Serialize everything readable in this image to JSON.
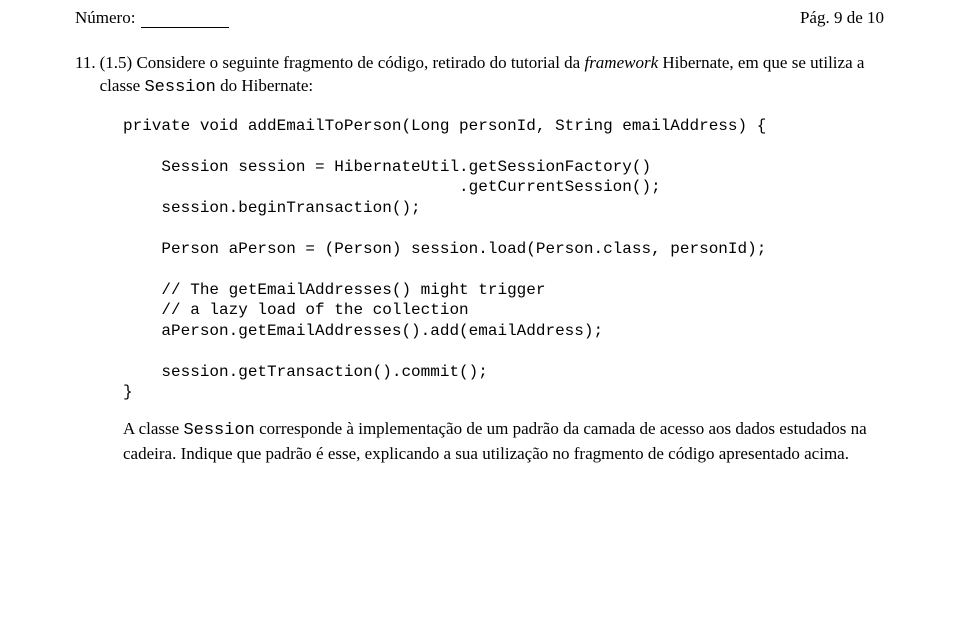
{
  "header": {
    "numero_label": "Número:",
    "page_label": "Pág. 9 de 10"
  },
  "question": {
    "num": "11.",
    "points": "(1.5)",
    "text_part1": " Considere o seguinte fragmento de código, retirado do tutorial da ",
    "framework_word": "framework",
    "text_part2": " Hibernate, em que se utiliza a classe ",
    "session_word": "Session",
    "text_part3": " do Hibernate:"
  },
  "code": {
    "line1": "private void addEmailToPerson(Long personId, String emailAddress) {",
    "line2": "",
    "line3": "    Session session = HibernateUtil.getSessionFactory()",
    "line4": "                                   .getCurrentSession();",
    "line5": "    session.beginTransaction();",
    "line6": "",
    "line7": "    Person aPerson = (Person) session.load(Person.class, personId);",
    "line8": "",
    "line9": "    // The getEmailAddresses() might trigger",
    "line10": "    // a lazy load of the collection",
    "line11": "    aPerson.getEmailAddresses().add(emailAddress);",
    "line12": "",
    "line13": "    session.getTransaction().commit();",
    "line14": "}"
  },
  "closing": {
    "part1": "A classe ",
    "session_word": "Session",
    "part2": " corresponde à implementação de um padrão da camada de acesso aos dados estudados na cadeira. Indique que padrão é esse, explicando a sua utilização no fragmento de código apresentado acima."
  }
}
